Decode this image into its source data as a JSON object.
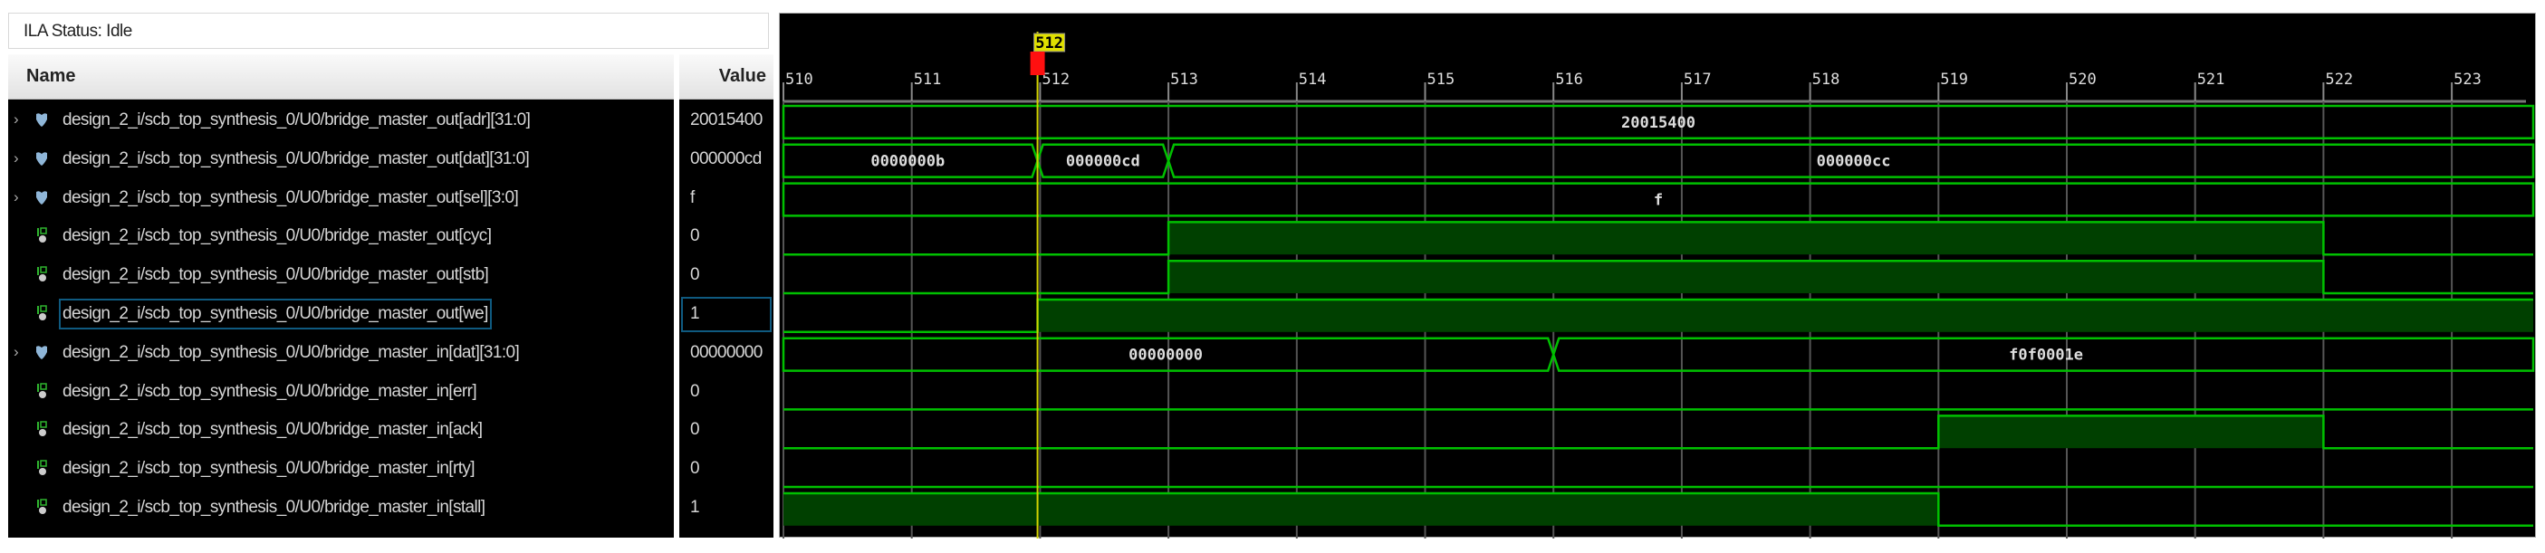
{
  "status": {
    "label": "ILA Status: Idle"
  },
  "columns": {
    "name": "Name",
    "value": "Value"
  },
  "colors": {
    "wave": "#00c000",
    "fill": "#004000",
    "grid": "#555555",
    "cursor": "#d4d400",
    "marker": "#ff1010",
    "selection": "#0f5a80"
  },
  "cursor": {
    "label": "512",
    "time": 511.98
  },
  "ruler": {
    "ticks": [
      "510",
      "511",
      "512",
      "513",
      "514",
      "515",
      "516",
      "517",
      "518",
      "519",
      "520",
      "521",
      "522",
      "523"
    ],
    "start": 510
  },
  "signals": [
    {
      "name": "design_2_i/scb_top_synthesis_0/U0/bridge_master_out[adr][31:0]",
      "value": "20015400",
      "type": "bus",
      "icon": "bus-icon",
      "segments": [
        {
          "from": 510,
          "to": 524,
          "label": "20015400"
        }
      ]
    },
    {
      "name": "design_2_i/scb_top_synthesis_0/U0/bridge_master_out[dat][31:0]",
      "value": "000000cd",
      "type": "bus",
      "icon": "bus-icon",
      "segments": [
        {
          "from": 510,
          "to": 511.98,
          "label": "0000000b"
        },
        {
          "from": 511.98,
          "to": 513,
          "label": "000000cd"
        },
        {
          "from": 513,
          "to": 524,
          "label": "000000cc"
        }
      ]
    },
    {
      "name": "design_2_i/scb_top_synthesis_0/U0/bridge_master_out[sel][3:0]",
      "value": "f",
      "type": "bus",
      "icon": "bus-icon",
      "segments": [
        {
          "from": 510,
          "to": 524,
          "label": "f"
        }
      ]
    },
    {
      "name": "design_2_i/scb_top_synthesis_0/U0/bridge_master_out[cyc]",
      "value": "0",
      "type": "bit",
      "icon": "bit-icon",
      "initial": 0,
      "edges": [
        513,
        522
      ]
    },
    {
      "name": "design_2_i/scb_top_synthesis_0/U0/bridge_master_out[stb]",
      "value": "0",
      "type": "bit",
      "icon": "bit-icon",
      "initial": 0,
      "edges": [
        513,
        522
      ]
    },
    {
      "name": "design_2_i/scb_top_synthesis_0/U0/bridge_master_out[we]",
      "value": "1",
      "type": "bit",
      "icon": "bit-icon",
      "initial": 0,
      "edges": [
        511.98
      ],
      "selected": true
    },
    {
      "name": "design_2_i/scb_top_synthesis_0/U0/bridge_master_in[dat][31:0]",
      "value": "00000000",
      "type": "bus",
      "icon": "bus-icon",
      "segments": [
        {
          "from": 510,
          "to": 516,
          "label": "00000000"
        },
        {
          "from": 516,
          "to": 524,
          "label": "f0f0001e"
        }
      ]
    },
    {
      "name": "design_2_i/scb_top_synthesis_0/U0/bridge_master_in[err]",
      "value": "0",
      "type": "bit",
      "icon": "bit-icon",
      "initial": 0,
      "edges": []
    },
    {
      "name": "design_2_i/scb_top_synthesis_0/U0/bridge_master_in[ack]",
      "value": "0",
      "type": "bit",
      "icon": "bit-icon",
      "initial": 0,
      "edges": [
        519,
        522
      ]
    },
    {
      "name": "design_2_i/scb_top_synthesis_0/U0/bridge_master_in[rty]",
      "value": "0",
      "type": "bit",
      "icon": "bit-icon",
      "initial": 0,
      "edges": []
    },
    {
      "name": "design_2_i/scb_top_synthesis_0/U0/bridge_master_in[stall]",
      "value": "1",
      "type": "bit",
      "icon": "bit-icon",
      "initial": 1,
      "edges": [
        519
      ]
    }
  ]
}
